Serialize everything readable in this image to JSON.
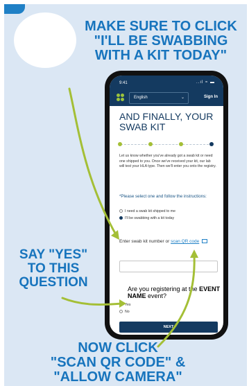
{
  "instructions": {
    "top": [
      "MAKE SURE TO CLICK",
      "\"I'LL BE SWABBING",
      "WITH A KIT TODAY\""
    ],
    "yes": [
      "SAY \"YES\"",
      "TO THIS",
      "QUESTION"
    ],
    "bottom": [
      "NOW CLICK",
      "\"SCAN QR CODE\" &",
      "\"ALLOW CAMERA\""
    ]
  },
  "phone": {
    "status": {
      "time": "9:41",
      "signal": "..ıl ≈ ▬"
    },
    "header": {
      "language": "English",
      "sign_in": "Sign In"
    },
    "title": "AND FINALLY, YOUR SWAB KIT",
    "intro": "Let us know whether you've already got a swab kit or need one shipped to you. Once we've received your kit, our lab will test your HLA type. Then we'll enter you onto the registry.",
    "question1": "*Please select one and follow the instructions:",
    "options": [
      "I need a swab kit shipped to me",
      "I'll be swabbing with a kit today"
    ],
    "swab": {
      "label": "Enter swab kit number or",
      "link": "scan QR code"
    },
    "question2": {
      "prefix": "Are you registering at the",
      "event": "EVENT NAME",
      "suffix": "event?"
    },
    "answers": [
      "Yes",
      "No"
    ],
    "next": "NEXT"
  },
  "colors": {
    "accent_blue": "#1774bd",
    "navy": "#143a60",
    "arrow_green": "#a4bf36",
    "panel": "#dbe7f4"
  }
}
